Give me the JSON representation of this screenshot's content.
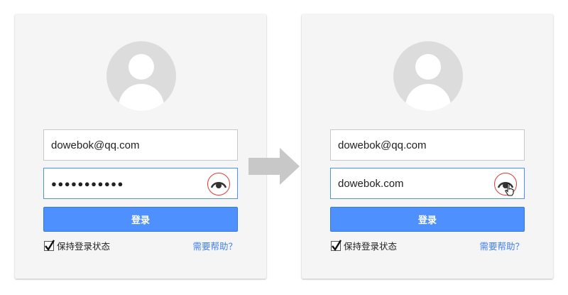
{
  "left_card": {
    "email_value": "dowebok@qq.com",
    "password_masked": "●●●●●●●●●●●",
    "login_label": "登录",
    "remember_label": "保持登录状态",
    "remember_checked": true,
    "help_label": "需要帮助？"
  },
  "right_card": {
    "email_value": "dowebok@qq.com",
    "password_revealed": "dowebok.com",
    "login_label": "登录",
    "remember_label": "保持登录状态",
    "remember_checked": true,
    "help_label": "需要帮助？"
  },
  "icons": {
    "avatar": "avatar-placeholder-icon",
    "eye": "eye-toggle-icon",
    "arrow": "right-arrow-icon",
    "cursor": "hand-pointer-icon"
  },
  "colors": {
    "card_bg": "#f5f5f5",
    "button_blue": "#4d90fe",
    "link_blue": "#427fed",
    "highlight_red": "#e53935",
    "arrow_gray": "#c8c8c8"
  }
}
